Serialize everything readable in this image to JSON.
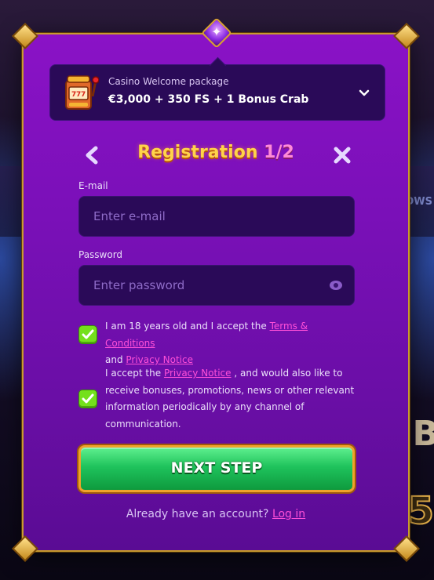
{
  "background": {
    "right_text": "OWS",
    "right_letter": "B",
    "right_number": "5"
  },
  "package": {
    "subtitle": "Casino Welcome package",
    "title": "€3,000 + 350 FS + 1 Bonus Crab",
    "icon": "slot-machine-icon",
    "chevron_icon": "chevron-down-icon"
  },
  "header": {
    "title": "Registration",
    "step": "1/2",
    "back_icon": "chevron-left-icon",
    "close_icon": "close-icon"
  },
  "form": {
    "email_label": "E-mail",
    "email_placeholder": "Enter e-mail",
    "email_value": "",
    "password_label": "Password",
    "password_placeholder": "Enter password",
    "password_value": "",
    "eye_icon": "eye-icon"
  },
  "consent": {
    "age_text_1": "I am 18 years old and I accept the ",
    "terms_link": "Terms & Conditions",
    "age_text_2": "and ",
    "privacy_link_1": "Privacy Notice",
    "marketing_text_1": "I accept the ",
    "privacy_link_2": "Privacy Notice",
    "marketing_text_2": " , and would also like to receive bonuses, promotions, news or other relevant information periodically by any channel of communication.",
    "age_checked": true,
    "marketing_checked": true
  },
  "actions": {
    "next_label": "NEXT STEP",
    "login_prompt": "Already have an account? ",
    "login_link": "Log in"
  },
  "colors": {
    "modal_purple": "#7a10b8",
    "field_bg": "#2a0a58",
    "accent_gold": "#ffd34a",
    "link_pink": "#ff4fd8",
    "check_green": "#74e01c",
    "button_green": "#1fc35c"
  }
}
